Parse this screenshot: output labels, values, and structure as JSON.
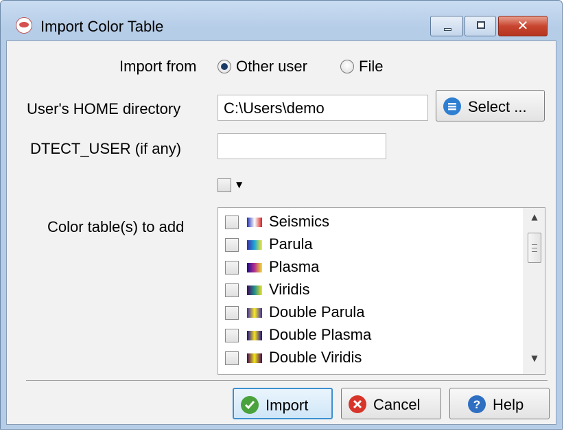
{
  "window": {
    "title": "Import Color Table",
    "controls": {
      "minimize": "minimize",
      "maximize": "maximize",
      "close": "✕"
    }
  },
  "import_from": {
    "label": "Import from",
    "options": [
      {
        "label": "Other user",
        "selected": true
      },
      {
        "label": "File",
        "selected": false
      }
    ]
  },
  "home_dir": {
    "label": "User's HOME directory",
    "value": "C:\\Users\\demo",
    "button_label": "Select ..."
  },
  "dtect_user": {
    "label": "DTECT_USER (if any)",
    "value": ""
  },
  "color_tables": {
    "label": "Color table(s) to add",
    "items": [
      {
        "label": "Seismics",
        "checked": false,
        "swatch": [
          "#1f2fb0",
          "#ffffff",
          "#d42020"
        ]
      },
      {
        "label": "Parula",
        "checked": false,
        "swatch": [
          "#3a2aa8",
          "#1fa7d6",
          "#f9e92a"
        ]
      },
      {
        "label": "Plasma",
        "checked": false,
        "swatch": [
          "#1a0a8c",
          "#b5308f",
          "#f5e227"
        ]
      },
      {
        "label": "Viridis",
        "checked": false,
        "swatch": [
          "#44045a",
          "#22908b",
          "#f1e51d"
        ]
      },
      {
        "label": "Double Parula",
        "checked": false,
        "swatch": [
          "#3a2aa8",
          "#f9e92a",
          "#3a2aa8"
        ]
      },
      {
        "label": "Double Plasma",
        "checked": false,
        "swatch": [
          "#1a0a8c",
          "#f5e227",
          "#1a0a8c"
        ]
      },
      {
        "label": "Double Viridis",
        "checked": false,
        "swatch": [
          "#44045a",
          "#f1e51d",
          "#44045a"
        ]
      }
    ]
  },
  "buttons": {
    "import": "Import",
    "cancel": "Cancel",
    "help": "Help"
  },
  "colors": {
    "title_bar": "#b6cde8",
    "dialog_bg": "#f2f2f2",
    "accent": "#3c8fcf",
    "close_red": "#c8452f"
  }
}
